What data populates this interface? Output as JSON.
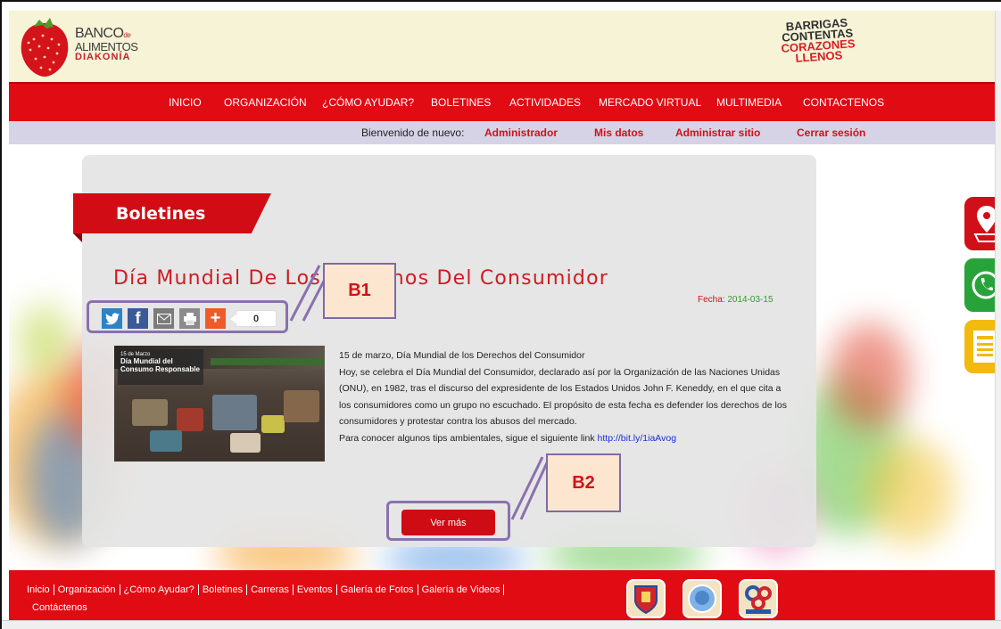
{
  "header": {
    "logo": {
      "line1": "BANCO",
      "line1_small": "de",
      "line2": "ALIMENTOS",
      "line3": "DIAKONÍA"
    },
    "slogan": {
      "line1": "BARRIGAS",
      "line2": "CONTENTAS",
      "line3": "CORAZONES",
      "line4": "LLENOS"
    }
  },
  "nav": {
    "items": [
      {
        "label": "INICIO"
      },
      {
        "label": "ORGANIZACIÓN"
      },
      {
        "label": "¿CÓMO AYUDAR?"
      },
      {
        "label": "BOLETINES"
      },
      {
        "label": "ACTIVIDADES"
      },
      {
        "label": "MERCADO VIRTUAL"
      },
      {
        "label": "MULTIMEDIA"
      },
      {
        "label": "CONTACTENOS"
      }
    ]
  },
  "userbar": {
    "welcome": "Bienvenido de nuevo:",
    "links": [
      "Administrador",
      "Mis datos",
      "Administrar sitio",
      "Cerrar sesión"
    ]
  },
  "section": {
    "title": "Boletines"
  },
  "post": {
    "title": "Día Mundial De Los Derechos Del Consumidor",
    "date_label": "Fecha:",
    "date_value": "2014-03-15",
    "share_count": "0",
    "image": {
      "tag_date": "15 de Marzo",
      "tag_title": "Día Mundial del Consumo Responsable"
    },
    "paragraphs": [
      "15 de marzo, Día Mundial de los Derechos del Consumidor",
      "Hoy, se celebra el Día Mundial del Consumidor, declarado así por la Organización de las Naciones Unidas (ONU), en 1982, tras el discurso del expresidente de los Estados Unidos John F. Keneddy, en el que cita a los consumidores como un grupo no escuchado. El propósito de esta fecha es defender los derechos de los consumidores y protestar contra los abusos del mercado."
    ],
    "tips_text": "Para conocer algunos tips ambientales, sigue el siguiente link ",
    "tips_link": "http://bit.ly/1iaAvog",
    "more_label": "Ver más"
  },
  "annotations": {
    "b1": "B1",
    "b2": "B2"
  },
  "footer": {
    "links": [
      "Inicio",
      "Organización",
      "¿Cómo Ayudar?",
      "Boletines",
      "Carreras",
      "Eventos",
      "Galería de Fotos",
      "Galería de Videos",
      "Contáctenos"
    ]
  },
  "colors": {
    "brand_red": "#e10b13",
    "accent_green": "#3a9a26",
    "annotation": "#8a71ad"
  }
}
